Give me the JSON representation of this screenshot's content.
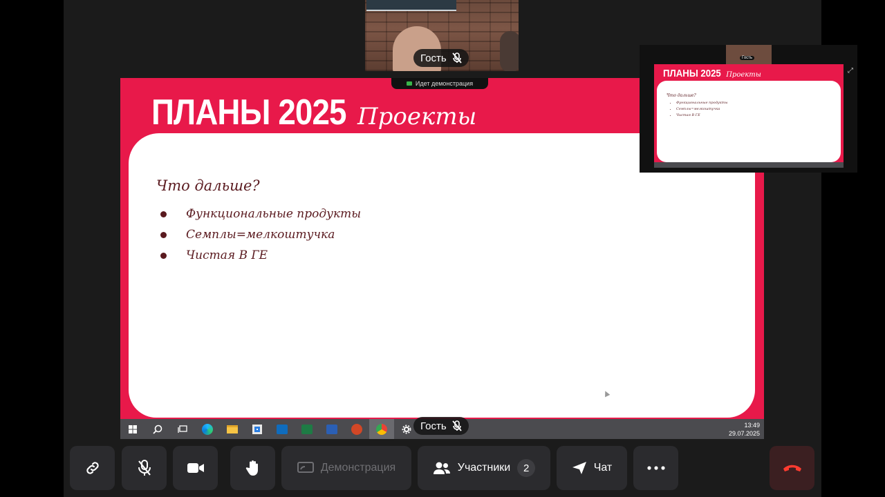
{
  "colors": {
    "slide_red": "#e8194a",
    "slide_text": "#5a1a1f",
    "control_bg": "#2b2b2e",
    "hangup_red": "#ff3b30"
  },
  "camera": {
    "name": "Гость",
    "mic_icon": "mic-off-icon"
  },
  "demo_tab": {
    "label": "Идет демонстрация"
  },
  "slide": {
    "title": "ПЛАНЫ 2025",
    "subtitle": "Проекты",
    "question": "Что дальше?",
    "items": [
      "Функциональные продукты",
      "Семплы=мелкоштучка",
      "Чистая В ГЕ"
    ]
  },
  "taskbar": {
    "time": "13:49",
    "date": "29.07.2025",
    "icons": [
      "windows-start-icon",
      "search-icon",
      "task-view-icon",
      "edge-icon",
      "file-explorer-icon",
      "store-icon",
      "outlook-icon",
      "excel-icon",
      "word-icon",
      "powerpoint-icon",
      "chrome-icon",
      "settings-icon"
    ]
  },
  "screen_pill": {
    "name": "Гость"
  },
  "thumbnail": {
    "cam_name": "Гость",
    "title": "ПЛАНЫ 2025",
    "subtitle": "Проекты",
    "question": "Что дальше?",
    "items": [
      "Функциональные продукты",
      "Семплы=мелкоштучка",
      "Чистая В ГЕ"
    ],
    "cam_name2": "Гость"
  },
  "controls": {
    "demo_label": "Демонстрация",
    "participants_label": "Участники",
    "participants_count": "2",
    "chat_label": "Чат"
  }
}
